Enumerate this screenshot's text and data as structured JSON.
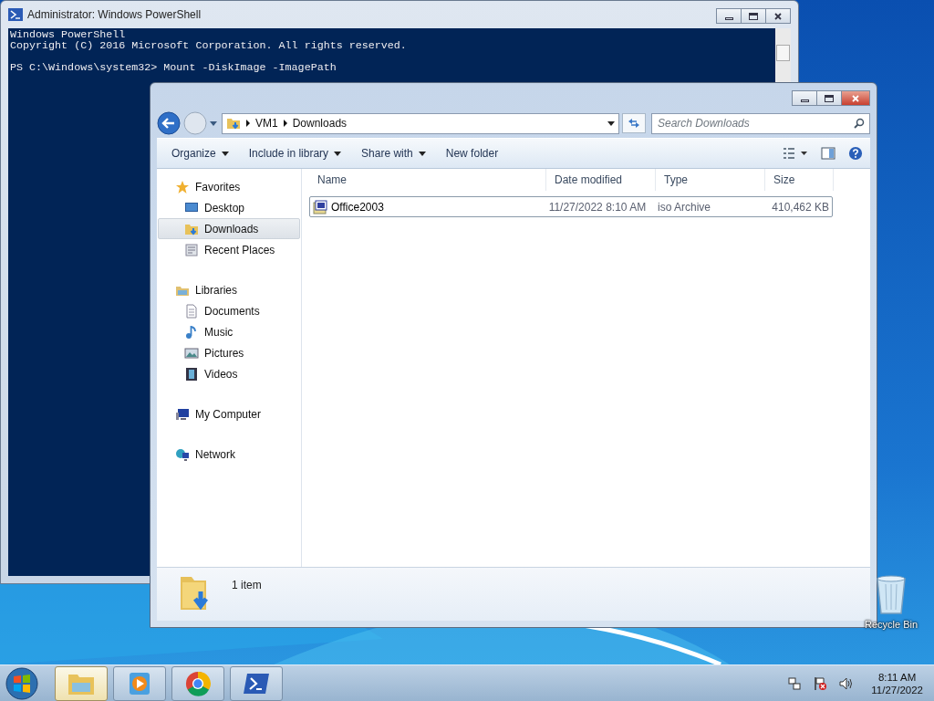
{
  "powershell": {
    "title": "Administrator: Windows PowerShell",
    "lines": [
      {
        "text": "Windows PowerShell",
        "gap_before": false
      },
      {
        "text": "Copyright (C) 2016 Microsoft Corporation. All rights reserved.",
        "gap_before": false
      },
      {
        "text": "PS C:\\Windows\\system32> Mount -DiskImage -ImagePath",
        "gap_before": true
      }
    ]
  },
  "explorer": {
    "breadcrumb": [
      "VM1",
      "Downloads"
    ],
    "search": {
      "placeholder": "Search Downloads"
    },
    "toolbar": [
      {
        "label": "Organize",
        "dropdown": true
      },
      {
        "label": "Include in library",
        "dropdown": true
      },
      {
        "label": "Share with",
        "dropdown": true
      },
      {
        "label": "New folder",
        "dropdown": false
      }
    ],
    "nav": [
      {
        "label": "Favorites",
        "kind": "star",
        "selected": false,
        "children": [
          {
            "label": "Desktop",
            "kind": "desktop",
            "selected": false
          },
          {
            "label": "Downloads",
            "kind": "downloads",
            "selected": true
          },
          {
            "label": "Recent Places",
            "kind": "recent",
            "selected": false
          }
        ]
      },
      {
        "label": "Libraries",
        "kind": "library",
        "selected": false,
        "children": [
          {
            "label": "Documents",
            "kind": "document",
            "selected": false
          },
          {
            "label": "Music",
            "kind": "music",
            "selected": false
          },
          {
            "label": "Pictures",
            "kind": "pictures",
            "selected": false
          },
          {
            "label": "Videos",
            "kind": "videos",
            "selected": false
          }
        ]
      },
      {
        "label": "My Computer",
        "kind": "computer",
        "selected": false
      },
      {
        "label": "Network",
        "kind": "network",
        "selected": false
      }
    ],
    "columns": [
      "Name",
      "Date modified",
      "Type",
      "Size"
    ],
    "rows": [
      {
        "name": "Office2003",
        "date": "11/27/2022 8:10 AM",
        "type": "iso Archive",
        "size": "410,462 KB",
        "selected": true
      }
    ],
    "status": "1 item"
  },
  "desktop_icons": [
    {
      "label": "Recycle Bin"
    }
  ],
  "taskbar": {
    "apps": [
      {
        "kind": "explorer",
        "active": true
      },
      {
        "kind": "media",
        "active": false
      },
      {
        "kind": "browser",
        "active": false
      },
      {
        "kind": "shell",
        "active": false
      }
    ],
    "time": "8:11 AM",
    "date": "11/27/2022"
  }
}
